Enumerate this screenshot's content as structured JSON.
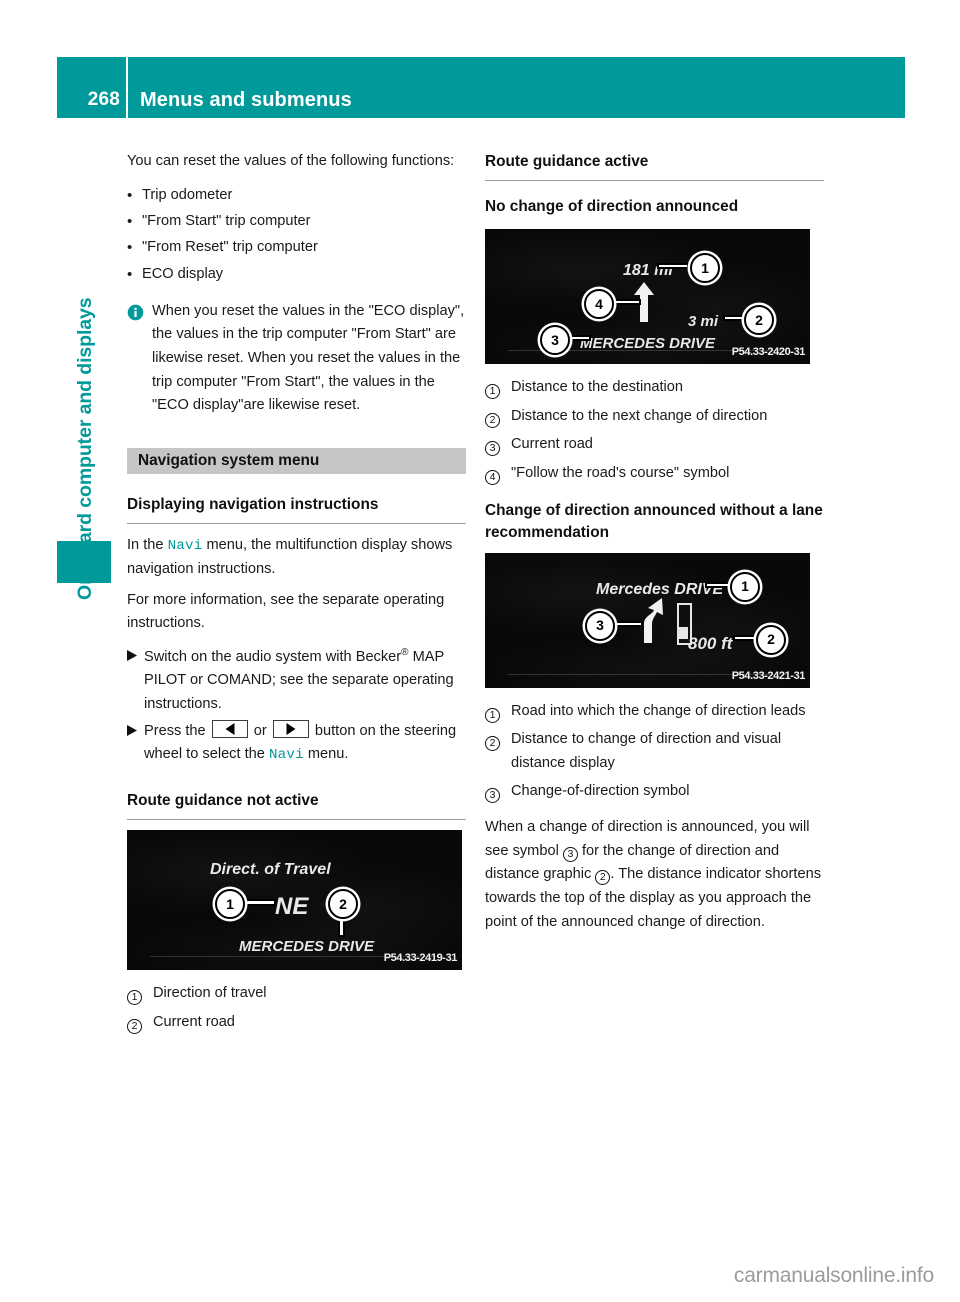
{
  "header": {
    "page_number": "268",
    "title": "Menus and submenus"
  },
  "sidebar": {
    "chapter_title": "On-board computer and displays"
  },
  "footer": {
    "watermark": "carmanualsonline.info"
  },
  "left_column": {
    "intro": "You can reset the values of the following functions:",
    "bullets": [
      "Trip odometer",
      "\"From Start\" trip computer",
      "\"From Reset\" trip computer",
      "ECO display"
    ],
    "note": "When you reset the values in the \"ECO display\", the values in the trip computer \"From Start\" are likewise reset. When you reset the values in the trip computer \"From Start\", the values in the \"ECO display\"are likewise reset.",
    "banner": "Navigation system menu",
    "subhead_display_nav": "Displaying navigation instructions",
    "nav_para_1_a": "In the",
    "nav_keyword": "Navi",
    "nav_para_1_b": "menu, the multifunction display shows navigation instructions.",
    "nav_para_2": "For more information, see the separate operating instructions.",
    "step_1_a": "Switch on the audio system with Becker",
    "step_1_sup": "®",
    "step_1_b": "MAP PILOT or COMAND; see the separate operating instructions.",
    "step_2_a": "Press the",
    "step_2_or": "or",
    "step_2_b": "button on the",
    "step_2_c": "steering wheel to select the",
    "step_2_d": "menu.",
    "subhead_route_not_active": "Route guidance not active",
    "figure_1": {
      "code": "P54.33-2419-31",
      "label_heading": "Direct. of Travel",
      "label_direction": "NE",
      "label_road": "MERCEDES DRIVE",
      "callouts": [
        "1",
        "2"
      ]
    },
    "captions_1": [
      {
        "num": "1",
        "text": "Direction of travel"
      },
      {
        "num": "2",
        "text": "Current road"
      }
    ]
  },
  "right_column": {
    "subhead_route_active": "Route guidance active",
    "subhead_no_change": "No change of direction announced",
    "figure_2": {
      "code": "P54.33-2420-31",
      "label_distance_destination": "181 mi",
      "label_distance_next": "3 mi",
      "label_road": "MERCEDES DRIVE",
      "callouts": [
        "1",
        "2",
        "3",
        "4"
      ]
    },
    "captions_2": [
      {
        "num": "1",
        "text": "Distance to the destination"
      },
      {
        "num": "2",
        "text": "Distance to the next change of direction"
      },
      {
        "num": "3",
        "text": "Current road"
      },
      {
        "num": "4",
        "text": "\"Follow the road's course\" symbol"
      }
    ],
    "subhead_change_announced": "Change of direction announced without a lane recommendation",
    "figure_3": {
      "code": "P54.33-2421-31",
      "label_road": "Mercedes DRIVE",
      "label_distance": "800 ft",
      "callouts": [
        "1",
        "2",
        "3"
      ]
    },
    "captions_3": [
      {
        "num": "1",
        "text": "Road into which the change of direction leads"
      },
      {
        "num": "2",
        "text": "Distance to change of direction and visual distance display"
      },
      {
        "num": "3",
        "text": "Change-of-direction symbol"
      }
    ],
    "closing_a": "When a change of direction is announced, you will see symbol",
    "closing_sym_1": "3",
    "closing_b": "for the change of direction and distance graphic",
    "closing_sym_2": "2",
    "closing_c": ". The distance indicator shortens towards the top of the display as you approach the point of the announced change of direction."
  },
  "colors": {
    "accent_teal": "#009a9a",
    "banner_gray": "#c6c6c6",
    "rule_gray": "#9d9d9d",
    "watermark_gray": "#9b9b9b"
  }
}
